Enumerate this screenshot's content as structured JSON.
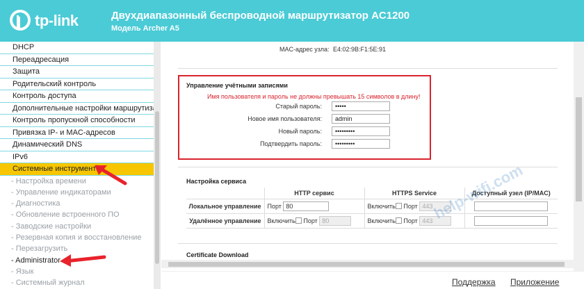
{
  "header": {
    "logo_text": "tp-link",
    "title": "Двухдиапазонный беспроводной маршрутизатор AC1200",
    "model": "Модель Archer A5"
  },
  "sidebar": {
    "items": [
      {
        "label": "DHCP"
      },
      {
        "label": "Переадресация"
      },
      {
        "label": "Защита"
      },
      {
        "label": "Родительский контроль"
      },
      {
        "label": "Контроль доступа"
      },
      {
        "label": "Дополнительные настройки маршрутизации"
      },
      {
        "label": "Контроль пропускной способности"
      },
      {
        "label": "Привязка IP- и MAC-адресов"
      },
      {
        "label": "Динамический DNS"
      },
      {
        "label": "IPv6"
      },
      {
        "label": "Системные инструменты"
      }
    ],
    "subitems": [
      {
        "label": "- Настройка времени"
      },
      {
        "label": "- Управление индикаторами"
      },
      {
        "label": "- Диагностика"
      },
      {
        "label": "- Обновление встроенного ПО"
      },
      {
        "label": "- Заводские настройки"
      },
      {
        "label": "- Резервная копия и восстановление"
      },
      {
        "label": "- Перезагрузить"
      },
      {
        "label": "- Administrator"
      },
      {
        "label": "- Язык"
      },
      {
        "label": "- Системный журнал"
      }
    ]
  },
  "main": {
    "mac_label": "MAC-адрес узла:",
    "mac_value": "E4:02:9B:F1:5E:91",
    "account": {
      "title": "Управление учётными записями",
      "warning": "Имя пользователя и пароль не должны превышать 15 символов в длину!",
      "old_password_label": "Старый пароль:",
      "old_password_value": "•••••",
      "new_user_label": "Новое имя пользователя:",
      "new_user_value": "admin",
      "new_password_label": "Новый пароль:",
      "new_password_value": "•••••••••",
      "confirm_password_label": "Подтвердить пароль:",
      "confirm_password_value": "•••••••••"
    },
    "service": {
      "title": "Настройка сервиса",
      "headers": [
        "",
        "HTTP сервис",
        "HTTPS Service",
        "Доступный узел (IP/MAC)"
      ],
      "local_label": "Локальное управление",
      "remote_label": "Удалённое управление",
      "port_label": "Порт",
      "enable_label": "Включить",
      "local_http_port": "80",
      "local_https_port": "443",
      "remote_http_port": "80",
      "remote_https_port": "443"
    },
    "cert_title": "Certificate Download"
  },
  "watermark": "help-wifi.com",
  "footer": {
    "support": "Поддержка",
    "app": "Приложение"
  }
}
